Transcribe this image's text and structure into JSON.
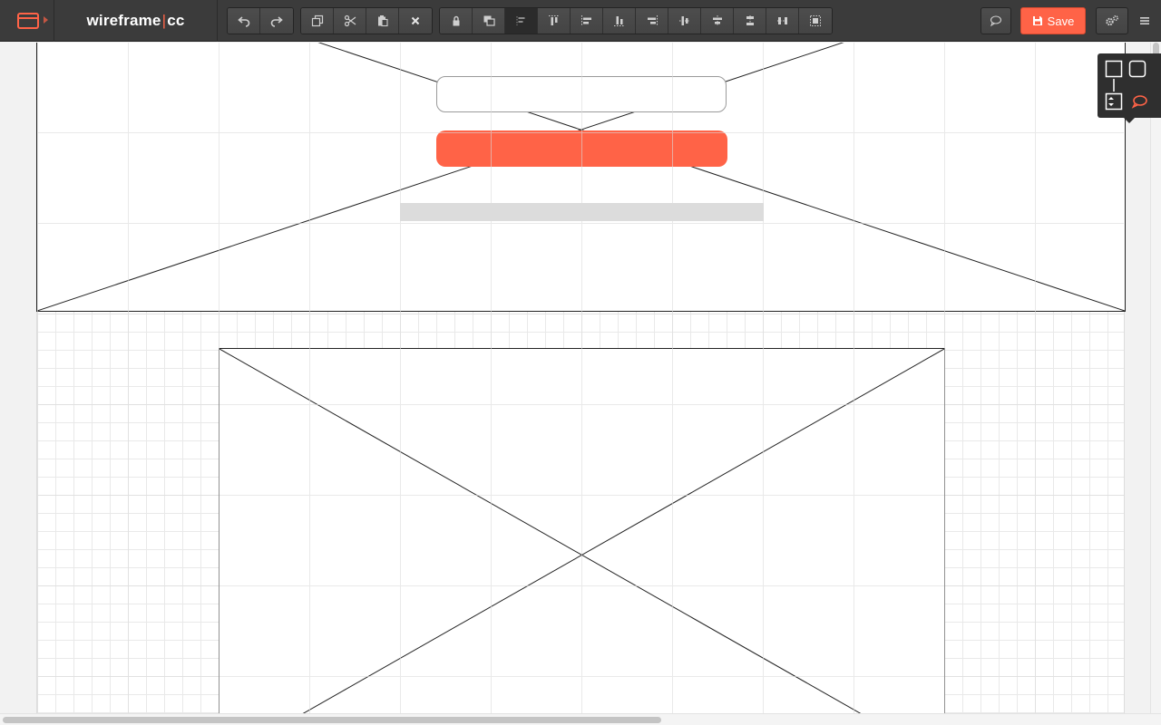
{
  "app": {
    "brand_name": "wireframe",
    "brand_separator": "|",
    "brand_suffix": "cc",
    "accent_color": "#ff6347"
  },
  "toolbar": {
    "history": [
      {
        "name": "undo-button",
        "icon": "undo-icon"
      },
      {
        "name": "redo-button",
        "icon": "redo-icon"
      }
    ],
    "clipboard": [
      {
        "name": "duplicate-button",
        "icon": "duplicate-icon"
      },
      {
        "name": "cut-button",
        "icon": "scissors-icon"
      },
      {
        "name": "paste-button",
        "icon": "paste-icon"
      },
      {
        "name": "delete-button",
        "icon": "close-icon"
      }
    ],
    "arrange": [
      {
        "name": "lock-button",
        "icon": "lock-icon"
      },
      {
        "name": "send-to-back-button",
        "icon": "layers-icon"
      },
      {
        "name": "align-text-button",
        "icon": "align-text-icon",
        "active": true
      },
      {
        "name": "align-top-button",
        "icon": "align-top-icon"
      },
      {
        "name": "align-left-button",
        "icon": "align-left-icon"
      },
      {
        "name": "align-bottom-button",
        "icon": "align-bottom-icon"
      },
      {
        "name": "align-right-button",
        "icon": "align-right-icon"
      },
      {
        "name": "align-center-vertical-button",
        "icon": "align-center-v-icon"
      },
      {
        "name": "align-center-horizontal-button",
        "icon": "align-center-h-icon"
      },
      {
        "name": "distribute-vertical-button",
        "icon": "distribute-v-icon"
      },
      {
        "name": "distribute-horizontal-button",
        "icon": "distribute-h-icon"
      },
      {
        "name": "group-button",
        "icon": "group-icon"
      }
    ],
    "save_label": "Save",
    "comment_icon": "speech-bubble-icon",
    "settings_icon": "gear-icon",
    "menu_icon": "hamburger-icon"
  },
  "palette": {
    "items": [
      "rectangle-shape-icon",
      "rounded-rectangle-shape-icon",
      "stepper-shape-icon",
      "comment-shape-icon"
    ]
  }
}
